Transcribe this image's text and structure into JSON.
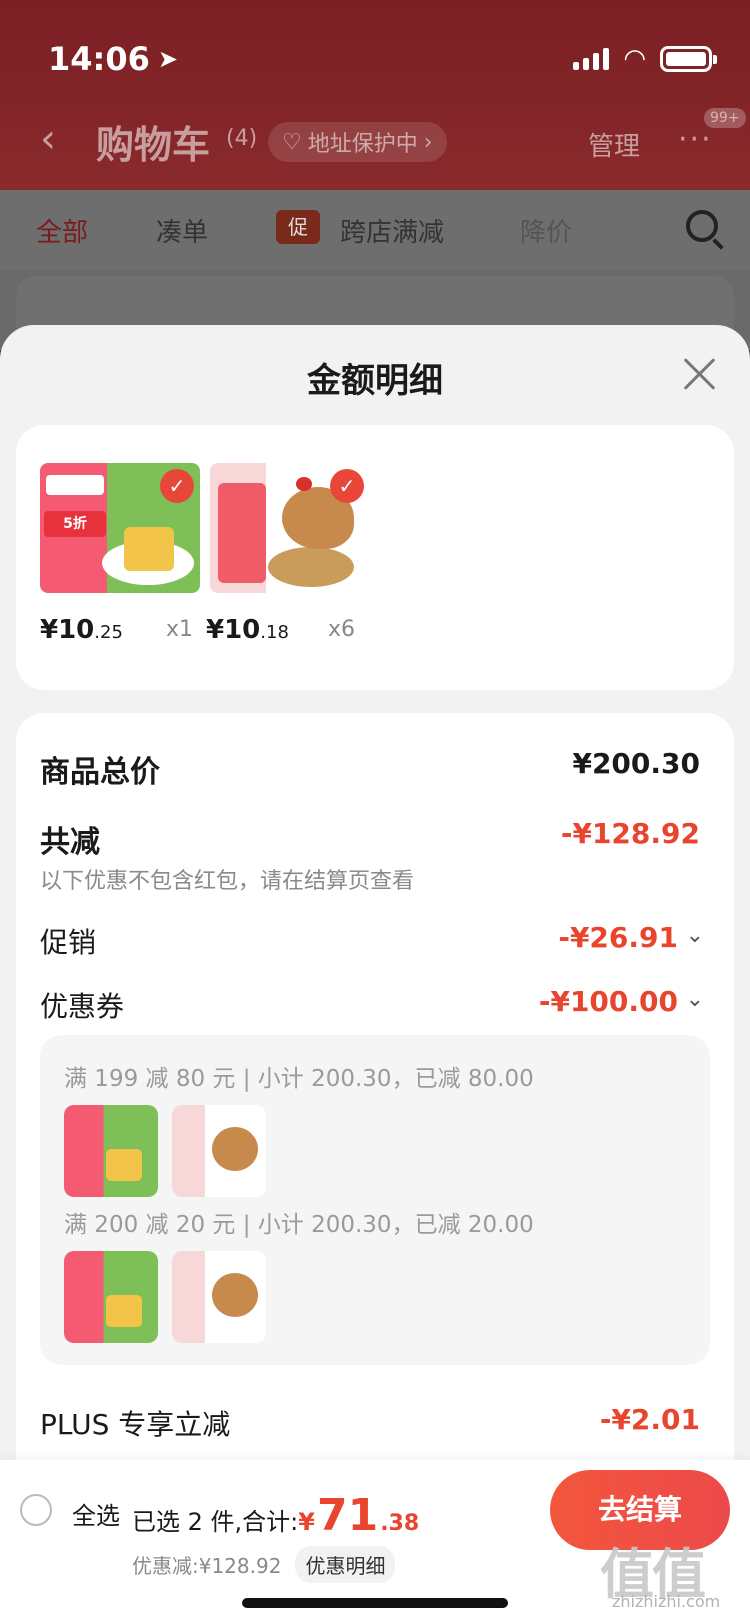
{
  "status_bar": {
    "time": "14:06"
  },
  "nav": {
    "back_icon": "‹",
    "title": "购物车",
    "count": "(4)",
    "address_protect": "地址保护中",
    "manage": "管理",
    "more_icon": "···",
    "badge": "99+"
  },
  "filters": {
    "all": "全部",
    "cou_dan": "凑单",
    "promo_tag": "促",
    "cross_store": "跨店满减",
    "price_drop": "降价"
  },
  "sheet": {
    "title": "金额明细",
    "products": [
      {
        "price_int": "¥10",
        "price_dec": ".25",
        "qty": "x1",
        "image": "tofu-product"
      },
      {
        "price_int": "¥10",
        "price_dec": ".18",
        "qty": "x6",
        "image": "chicken-product"
      }
    ],
    "details": {
      "total_label": "商品总价",
      "total_value": "¥200.30",
      "reduction_label": "共减",
      "reduction_value": "-¥128.92",
      "reduction_note": "以下优惠不包含红包，请在结算页查看",
      "promo_label": "促销",
      "promo_value": "-¥26.91",
      "coupon_label": "优惠券",
      "coupon_value": "-¥100.00",
      "coupon_lines": [
        "满 199 减 80 元 | 小计 200.30，已减 80.00",
        "满 200 减 20 元 | 小计 200.30，已减 20.00"
      ],
      "plus_label": "PLUS 专享立减",
      "plus_value": "-¥2.01"
    }
  },
  "bottom_bar": {
    "select_all": "全选",
    "selected_text": "已选 2 件,合计:",
    "total_yen": "¥",
    "total_int": "71",
    "total_dec": ".38",
    "discount_text": "优惠减:¥128.92",
    "detail_pill": "优惠明细",
    "checkout": "去结算"
  },
  "watermark": {
    "text": "值值值",
    "sub": "zhizhizhi.com"
  },
  "colors": {
    "accent_red": "#e8442e",
    "header_bg": "#7a1f24"
  }
}
